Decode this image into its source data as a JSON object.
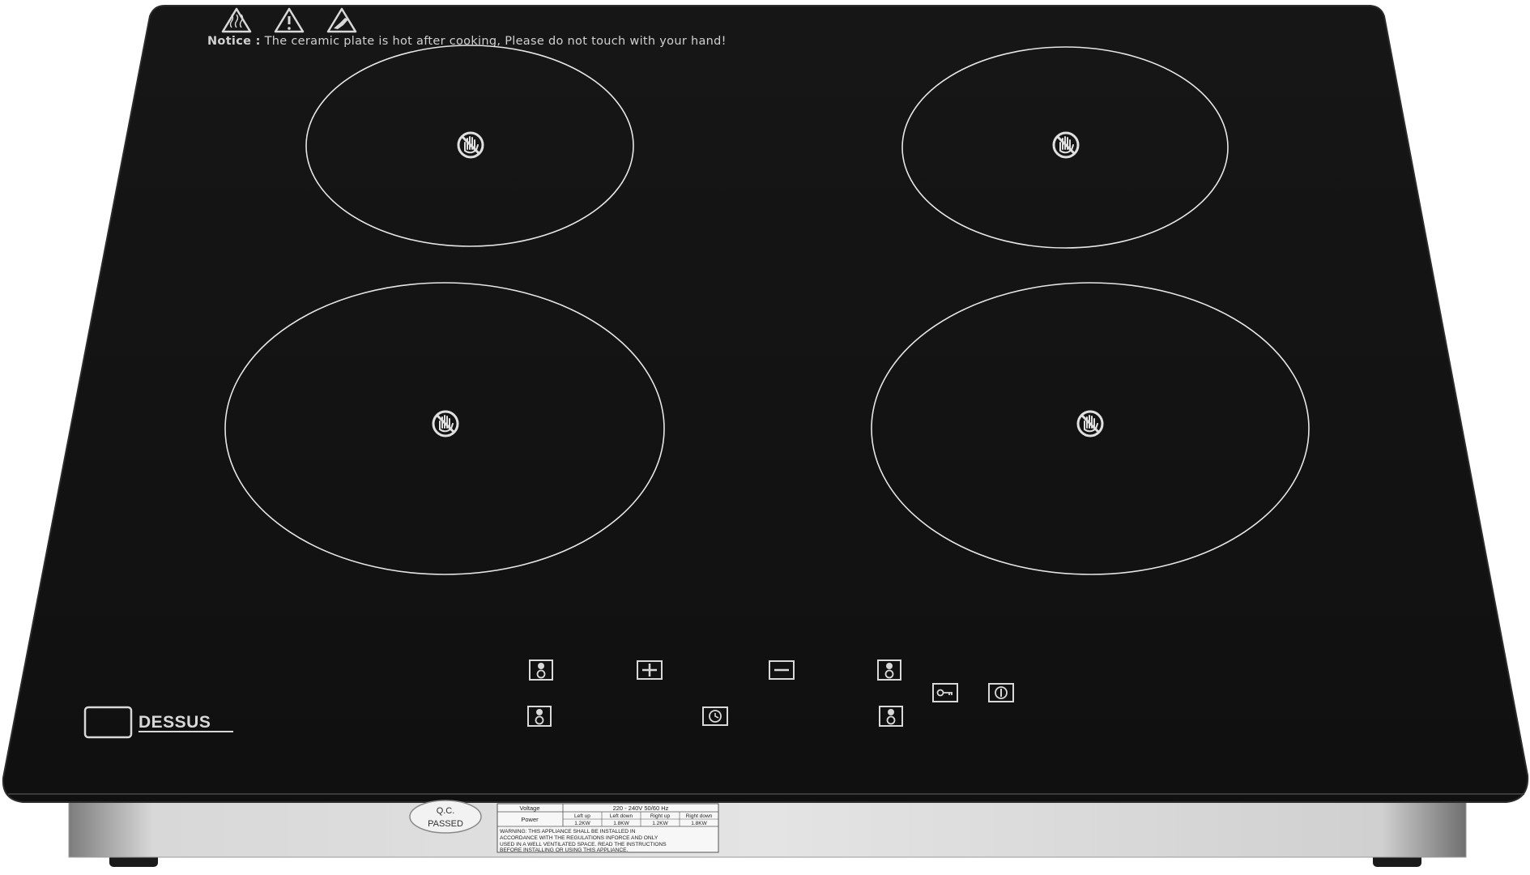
{
  "notice": {
    "label": "Notice :",
    "text": " The ceramic plate is hot after cooking, Please do not touch with your hand!",
    "warning_icons": [
      "hot-surface-warning-icon",
      "general-warning-icon",
      "hand-burn-warning-icon"
    ]
  },
  "burners": [
    {
      "name": "burner-top-left",
      "icon": "no-touch-hand-icon"
    },
    {
      "name": "burner-top-right",
      "icon": "no-touch-hand-icon"
    },
    {
      "name": "burner-bottom-left",
      "icon": "no-touch-hand-icon"
    },
    {
      "name": "burner-bottom-right",
      "icon": "no-touch-hand-icon"
    }
  ],
  "controls": {
    "zone_select_icon": "zone-select-icon",
    "plus_icon": "plus-icon",
    "minus_icon": "minus-icon",
    "timer_icon": "timer-icon",
    "lock_icon": "key-lock-icon",
    "power_icon": "power-icon"
  },
  "brand": {
    "name": "DESSUS",
    "logo_icon": "square-logo-icon"
  },
  "qc_sticker": {
    "line1": "Q.C.",
    "line2": "PASSED"
  },
  "rating_plate": {
    "voltage_label": "Voltage",
    "voltage_value": "220 - 240V 50/60 Hz",
    "power_label": "Power",
    "zone_headers": [
      "Left up",
      "Left down",
      "Right up",
      "Right down"
    ],
    "zone_powers": [
      "1.2KW",
      "1.8KW",
      "1.2KW",
      "1.8KW"
    ],
    "warning_lines": [
      "WARNING:  THIS APPLIANCE SHALL BE INSTALLED IN",
      "ACCORDANCE WITH THE REGULATIONS INFORCE AND ONLY",
      "USED IN A WELL VENTILATED SPACE. READ THE INSTRUCTIONS",
      "BEFORE INSTALLING OR USING THIS APPLIANCE."
    ]
  },
  "colors": {
    "glass": "#121212",
    "glass_edge": "#2a2a2a",
    "print": "#d8d8d8",
    "steel": "#cfcfcf",
    "steel_dark": "#8c8c8c",
    "background": "#ffffff"
  }
}
